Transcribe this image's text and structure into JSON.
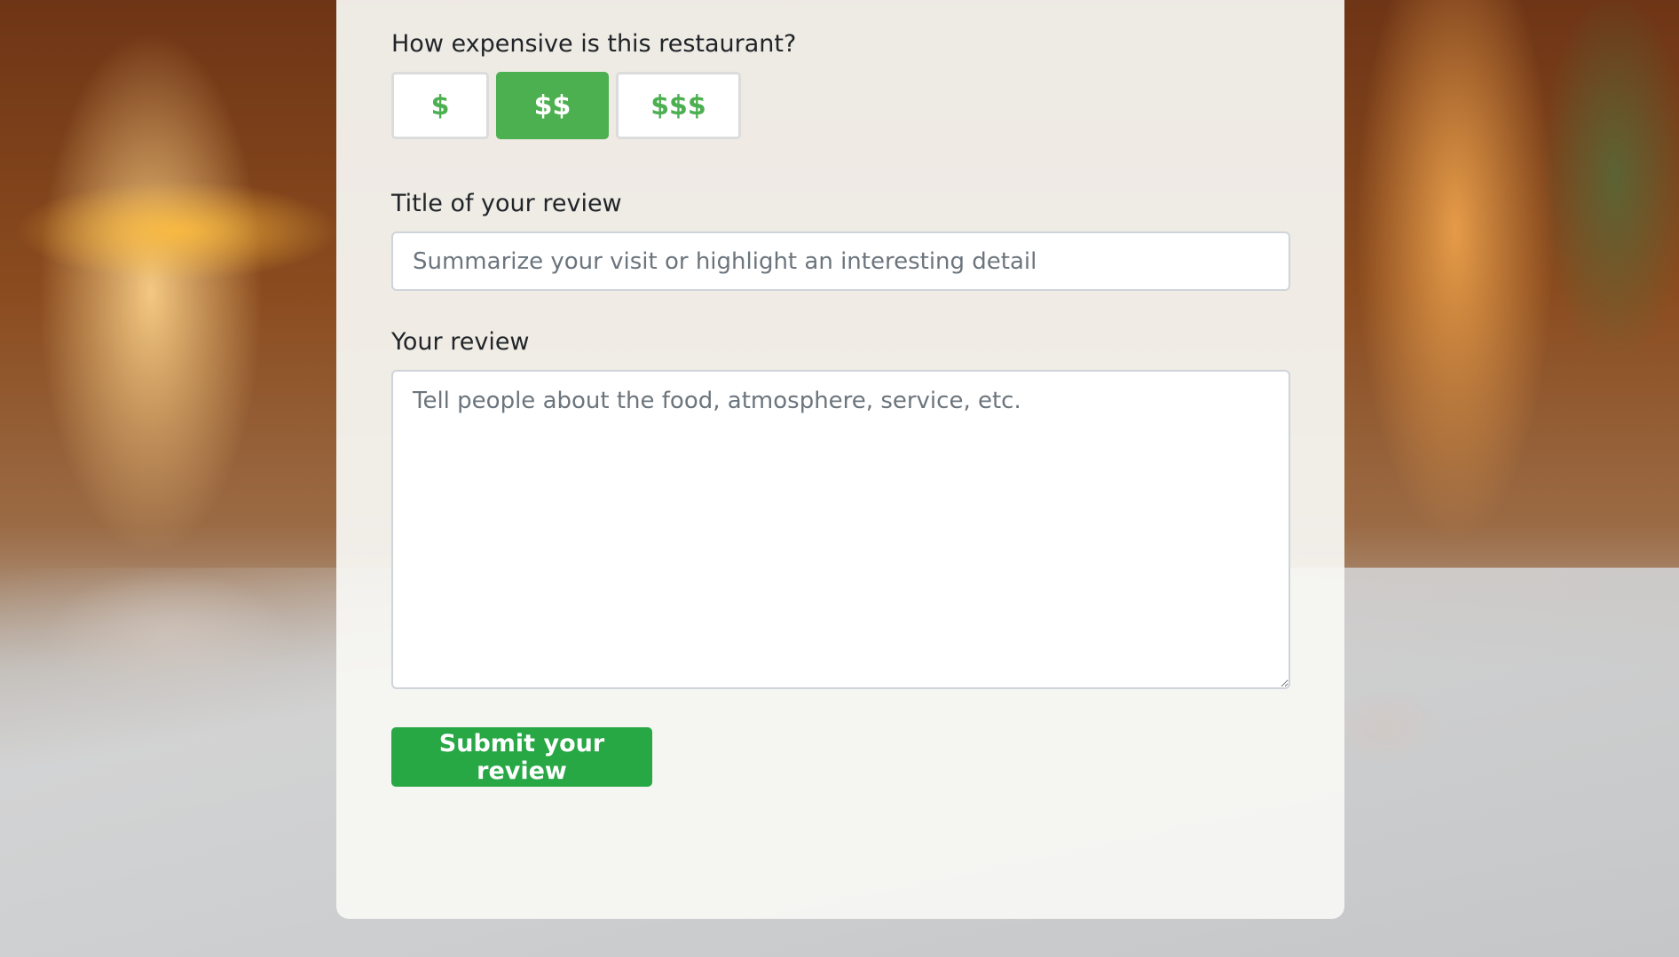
{
  "form": {
    "price_question": "How expensive is this restaurant?",
    "price_options": [
      {
        "label": "$",
        "selected": false
      },
      {
        "label": "$$",
        "selected": true
      },
      {
        "label": "$$$",
        "selected": false
      }
    ],
    "title_label": "Title of your review",
    "title_placeholder": "Summarize your visit or highlight an interesting detail",
    "review_label": "Your review",
    "review_placeholder": "Tell people about the food, atmosphere, service, etc.",
    "submit_label": "Submit your review"
  },
  "colors": {
    "accent": "#4caf50",
    "submit": "#28a745"
  }
}
